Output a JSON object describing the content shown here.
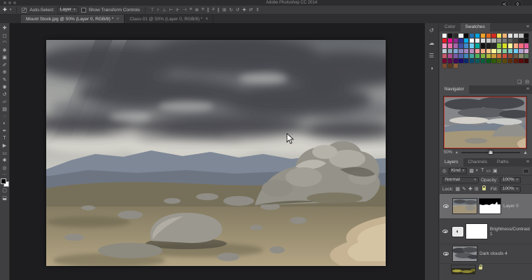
{
  "window": {
    "title": "Adobe Photoshop CC 2014",
    "overlay_share": "≺",
    "overlay_droplet": "◊"
  },
  "options_bar": {
    "tool_glyph": "✚",
    "auto_select_label": "Auto-Select:",
    "auto_select_checked": "✓",
    "auto_select_value": "Layer",
    "show_transform_label": "Show Transform Controls",
    "align_icons": [
      {
        "name": "align-top-icon",
        "glyph": "⊤"
      },
      {
        "name": "align-vcenter-icon",
        "glyph": "⊦"
      },
      {
        "name": "align-bottom-icon",
        "glyph": "⊥"
      },
      {
        "name": "align-left-icon",
        "glyph": "⊢"
      },
      {
        "name": "align-hcenter-icon",
        "glyph": "⊩"
      },
      {
        "name": "align-right-icon",
        "glyph": "⊣"
      },
      {
        "name": "distribute-top-icon",
        "glyph": "≡"
      },
      {
        "name": "distribute-vcenter-icon",
        "glyph": "≣"
      },
      {
        "name": "distribute-bottom-icon",
        "glyph": "≡"
      },
      {
        "name": "distribute-left-icon",
        "glyph": "∥"
      },
      {
        "name": "distribute-hcenter-icon",
        "glyph": "#"
      },
      {
        "name": "distribute-right-icon",
        "glyph": "∥"
      },
      {
        "name": "auto-align-icon",
        "glyph": "⊞"
      },
      {
        "name": "3d-rotate-icon",
        "glyph": "↻"
      },
      {
        "name": "3d-roll-icon",
        "glyph": "↺"
      },
      {
        "name": "3d-drag-icon",
        "glyph": "✚"
      },
      {
        "name": "3d-slide-icon",
        "glyph": "⇄"
      },
      {
        "name": "3d-scale-icon",
        "glyph": "⇕"
      }
    ]
  },
  "tabs": [
    {
      "label": "Mount Stock.jpg @ 50% (Layer 0, RGB/8) *",
      "close": "×"
    },
    {
      "label": "Class-01 @ 50% (Layer 0, RGB/8) *",
      "close": "×"
    }
  ],
  "toolbar": {
    "tools": [
      {
        "name": "move-tool",
        "glyph": "✚"
      },
      {
        "name": "marquee-tool",
        "glyph": "◻"
      },
      {
        "name": "lasso-tool",
        "glyph": "◠"
      },
      {
        "name": "quick-selection-tool",
        "glyph": "❋"
      },
      {
        "name": "crop-tool",
        "glyph": "▣"
      },
      {
        "name": "eyedropper-tool",
        "glyph": "✐"
      },
      {
        "name": "healing-brush-tool",
        "glyph": "⊕"
      },
      {
        "name": "brush-tool",
        "glyph": "✎"
      },
      {
        "name": "clone-stamp-tool",
        "glyph": "◉"
      },
      {
        "name": "history-brush-tool",
        "glyph": "↺"
      },
      {
        "name": "eraser-tool",
        "glyph": "▱"
      },
      {
        "name": "gradient-tool",
        "glyph": "▤"
      },
      {
        "name": "blur-tool",
        "glyph": "◌"
      },
      {
        "name": "dodge-tool",
        "glyph": "◐"
      },
      {
        "name": "pen-tool",
        "glyph": "✒"
      },
      {
        "name": "type-tool",
        "glyph": "T"
      },
      {
        "name": "path-selection-tool",
        "glyph": "▶"
      },
      {
        "name": "shape-tool",
        "glyph": "▭"
      },
      {
        "name": "hand-tool",
        "glyph": "✱"
      },
      {
        "name": "zoom-tool",
        "glyph": "◎"
      }
    ],
    "ellipsis": "⋯"
  },
  "collapsed_panels": [
    {
      "name": "history-panel-icon",
      "glyph": "↺"
    },
    {
      "name": "clone-source-panel-icon",
      "glyph": "☁"
    },
    {
      "name": "info-panel-icon",
      "glyph": "☰"
    },
    {
      "name": "adjustments-panel-icon",
      "glyph": "◑"
    }
  ],
  "panels": {
    "swatches": {
      "tab_color": "Color",
      "tab_swatches": "Swatches",
      "menu_icon": "≡",
      "new_icon": "❏",
      "trash_icon": "⊟",
      "colors": [
        "#ffffff",
        "#111111",
        "#2e2e2e",
        "#f5f5f5",
        "#0a0a0a",
        "#2271b3",
        "#04a3dd",
        "#f0a229",
        "#e0661f",
        "#cf2b20",
        "#f3df57",
        "#efb377",
        "#e2e2e2",
        "#d6d6d6",
        "#c2c2c2",
        "#101010",
        "#e41c24",
        "#ec0c8c",
        "#90278e",
        "#2e3192",
        "#00aeef",
        "#ffffff",
        "#efefef",
        "#dcdcdc",
        "#c6c6c6",
        "#adadad",
        "#939393",
        "#787878",
        "#5e5e5e",
        "#434343",
        "#2a2a2a",
        "#0d0d0d",
        "#f49ac1",
        "#ef6ea8",
        "#a864a8",
        "#3f51a3",
        "#4489cb",
        "#6dcff6",
        "#00a99d",
        "#111111",
        "#1d1d1d",
        "#2a2a2a",
        "#8dc63f",
        "#d7df23",
        "#fff799",
        "#f9ad81",
        "#f26d7d",
        "#e65c9c",
        "#bdccd4",
        "#8ca8bc",
        "#7da7d8",
        "#8781bd",
        "#a187be",
        "#bc8cbf",
        "#f5989d",
        "#f9ad81",
        "#fdc689",
        "#fff799",
        "#c4df9b",
        "#82ca9c",
        "#7accc8",
        "#6ecff6",
        "#b0a4cd",
        "#d3a8cf",
        "#c6566b",
        "#b04a8f",
        "#7d5aa8",
        "#4f63ad",
        "#3e8ab8",
        "#42a8a0",
        "#4fae58",
        "#7fb23e",
        "#b2b23a",
        "#c99a3a",
        "#c9703a",
        "#c94f3a",
        "#8a4a32",
        "#6e5a46",
        "#8a8a6e",
        "#5a7a5a",
        "#6e0a2e",
        "#5c0a4a",
        "#3e0a5c",
        "#1c0a6e",
        "#0a2a6e",
        "#0a4a6e",
        "#0a5c5c",
        "#0a5c3e",
        "#0a5c1c",
        "#2e5c0a",
        "#4a5c0a",
        "#5c4a0a",
        "#5c2e0a",
        "#5c1c0a",
        "#5c0a0a",
        "#3e0a0a",
        "#7b4a2d",
        "#5c3a22",
        "#8a5c36"
      ]
    },
    "navigator": {
      "title": "Navigator",
      "menu_icon": "≡",
      "zoom": "50%",
      "view_border_color": "#c0392b"
    },
    "layers": {
      "tab_layers": "Layers",
      "tab_channels": "Channels",
      "tab_paths": "Paths",
      "menu_icon": "≡",
      "search_icon": "◎",
      "kind_value": "Kind",
      "filter_icons": [
        {
          "name": "filter-pixel-icon",
          "glyph": "▦"
        },
        {
          "name": "filter-adjustment-icon",
          "glyph": "◐"
        },
        {
          "name": "filter-type-icon",
          "glyph": "T"
        },
        {
          "name": "filter-shape-icon",
          "glyph": "▭"
        },
        {
          "name": "filter-smart-object-icon",
          "glyph": "▣"
        }
      ],
      "blend_mode": "Normal",
      "opacity_label": "Opacity:",
      "opacity_value": "100%",
      "lock_label": "Lock:",
      "lock_icons": [
        {
          "name": "lock-transparency-icon",
          "glyph": "▦"
        },
        {
          "name": "lock-pixels-icon",
          "glyph": "✎"
        },
        {
          "name": "lock-position-icon",
          "glyph": "✚"
        },
        {
          "name": "lock-artboard-icon",
          "glyph": "⊞"
        }
      ],
      "fill_label": "Fill:",
      "fill_value": "100%",
      "rows": [
        {
          "name": "Layer 0"
        },
        {
          "name": "Brightness/Contrast 1"
        },
        {
          "name": "Dark clouds 4"
        },
        {
          "name": ""
        }
      ]
    }
  }
}
